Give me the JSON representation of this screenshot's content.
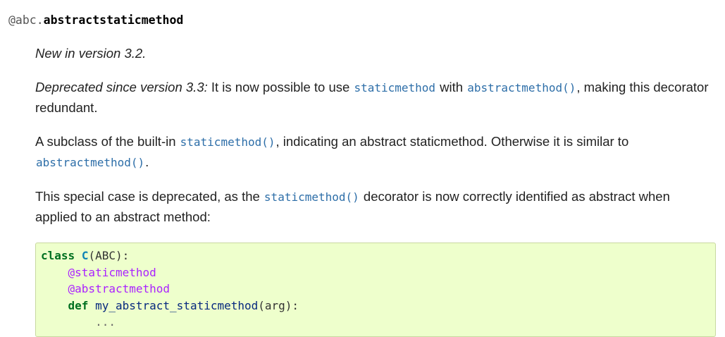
{
  "signature": {
    "prefix": "@abc.",
    "name": "abstractstaticmethod"
  },
  "paragraphs": {
    "new_in": "New in version 3.2.",
    "deprecated": {
      "label": "Deprecated since version 3.3:",
      "text1": " It is now possible to use ",
      "code1": "staticmethod",
      "text2": " with ",
      "code2": "abstractmethod()",
      "text3": ", making this decorator redundant."
    },
    "subclass": {
      "text1": "A subclass of the built-in ",
      "code1": "staticmethod()",
      "text2": ", indicating an abstract staticmethod. Otherwise it is similar to ",
      "code2": "abstractmethod()",
      "text3": "."
    },
    "special": {
      "text1": "This special case is deprecated, as the ",
      "code1": "staticmethod()",
      "text2": " decorator is now correctly identified as abstract when applied to an abstract method:"
    }
  },
  "code_example": {
    "line1_kw": "class",
    "line1_cls": "C",
    "line1_rest": "(ABC):",
    "line2_deco": "@staticmethod",
    "line3_deco": "@abstractmethod",
    "line4_kw": "def",
    "line4_fn": "my_abstract_staticmethod",
    "line4_rest": "(arg):",
    "line5": "..."
  },
  "colors": {
    "link_code": "#2d6ea8",
    "code_bg": "#eeffcc",
    "keyword": "#007020",
    "decorator": "#aa22ff",
    "function": "#06287e"
  }
}
